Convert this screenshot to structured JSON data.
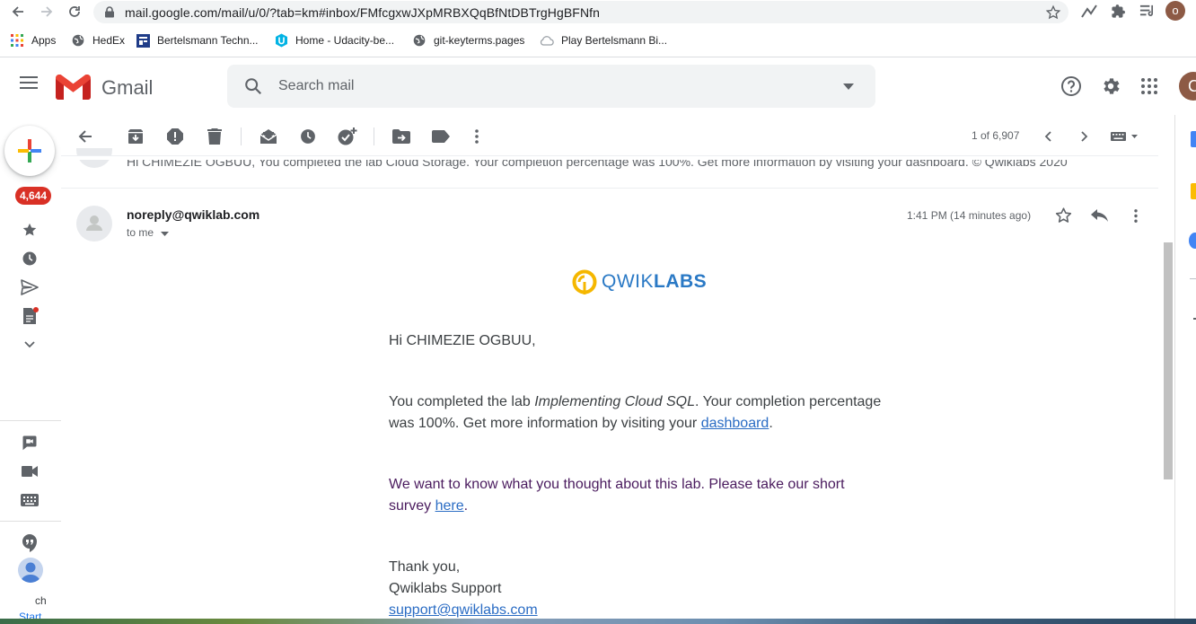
{
  "browser": {
    "url": "mail.google.com/mail/u/0/?tab=km#inbox/FMfcgxwJXpMRBXQqBfNtDBTrgHgBFNfn",
    "profile_initial": "o",
    "bookmarks": [
      "Apps",
      "HedEx",
      "Bertelsmann Techn...",
      "Home - Udacity-be...",
      "git-keyterms.pages",
      "Play Bertelsmann Bi..."
    ]
  },
  "header": {
    "app_name": "Gmail",
    "search_placeholder": "Search mail",
    "avatar_initial": "C"
  },
  "rail": {
    "inbox_badge": "4,644",
    "bottom_label_1": "ch",
    "bottom_label_2": "Start"
  },
  "toolbar": {
    "pagination": "1 of 6,907"
  },
  "thread": {
    "previous_snippet": "Hi CHIMEZIE OGBUU, You completed the lab Cloud Storage. Your completion percentage was 100%. Get more information by visiting your dashboard. © Qwiklabs 2020",
    "sender": "noreply@qwiklab.com",
    "to": "to me",
    "time": "1:41 PM (14 minutes ago)"
  },
  "email": {
    "logo_part1": "QWIK",
    "logo_part2": "LABS",
    "greeting": "Hi CHIMEZIE OGBUU,",
    "p1_a": "You completed the lab ",
    "p1_lab": "Implementing Cloud SQL",
    "p1_b": ". Your completion percentage was 100%. Get more information by visiting your ",
    "p1_link": "dashboard",
    "p1_end": ".",
    "p2_a": "We want to know what you thought about this lab. Please take our short survey ",
    "p2_link": "here",
    "p2_end": ".",
    "sign1": "Thank you,",
    "sign2": "Qwiklabs Support",
    "support_email": "support@qwiklabs.com"
  },
  "colors": {
    "accent_red": "#d93025",
    "qwiklabs_yellow": "#f5b700",
    "qwiklabs_blue": "#2a79c5",
    "link": "#2a6cc4",
    "survey_text": "#4a1b5e"
  }
}
